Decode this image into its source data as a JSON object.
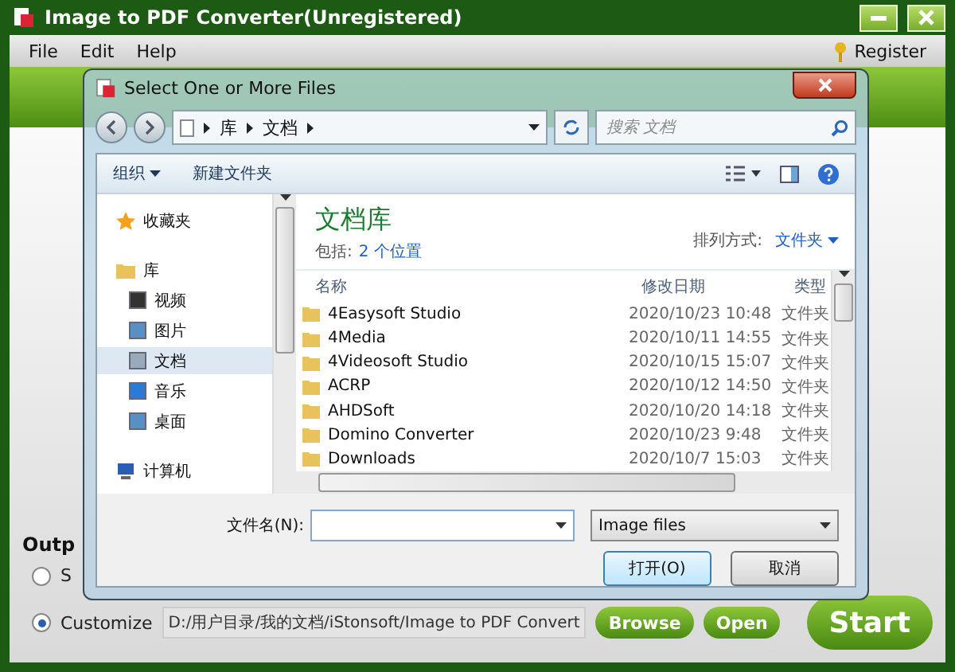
{
  "app": {
    "title": "Image to PDF Converter(Unregistered)",
    "menu": [
      "File",
      "Edit",
      "Help"
    ],
    "register": "Register"
  },
  "output": {
    "label": "Outp",
    "options": [
      {
        "label": "S",
        "selected": false
      },
      {
        "label": "Customize",
        "selected": true
      }
    ],
    "path": "D:/用户目录/我的文档/iStonsoft/Image to PDF Convert",
    "buttons": [
      "Browse",
      "Open"
    ],
    "start": "Start"
  },
  "dialog": {
    "title": "Select One or More Files",
    "breadcrumb": [
      "库",
      "文档"
    ],
    "search": {
      "placeholder": "搜索 文档"
    },
    "commands": [
      "组织",
      "新建文件夹"
    ],
    "nav": [
      {
        "label": "收藏夹",
        "selected": false
      },
      {
        "label": "库",
        "selected": false,
        "children": [
          {
            "label": "视频",
            "selected": false
          },
          {
            "label": "图片",
            "selected": false
          },
          {
            "label": "文档",
            "selected": true
          },
          {
            "label": "音乐",
            "selected": false
          },
          {
            "label": "桌面",
            "selected": false
          }
        ]
      },
      {
        "label": "计算机",
        "selected": false
      }
    ],
    "library": {
      "title": "文档库",
      "includes_label": "包括:",
      "includes_link": "2 个位置",
      "sort_label": "排列方式:",
      "sort_value": "文件夹"
    },
    "columns": [
      "名称",
      "修改日期",
      "类型"
    ],
    "rows": [
      {
        "name": "4Easysoft Studio",
        "date": "2020/10/23 10:48",
        "type": "文件夹"
      },
      {
        "name": "4Media",
        "date": "2020/10/11 14:55",
        "type": "文件夹"
      },
      {
        "name": "4Videosoft Studio",
        "date": "2020/10/15 15:07",
        "type": "文件夹"
      },
      {
        "name": "ACRP",
        "date": "2020/10/12 14:50",
        "type": "文件夹"
      },
      {
        "name": "AHDSoft",
        "date": "2020/10/20 14:18",
        "type": "文件夹"
      },
      {
        "name": "Domino Converter",
        "date": "2020/10/23 9:48",
        "type": "文件夹"
      },
      {
        "name": "Downloads",
        "date": "2020/10/7 15:03",
        "type": "文件夹"
      }
    ],
    "filename": {
      "label": "文件名(N):"
    },
    "filter": "Image files",
    "open": "打开(O)",
    "cancel": "取消"
  }
}
